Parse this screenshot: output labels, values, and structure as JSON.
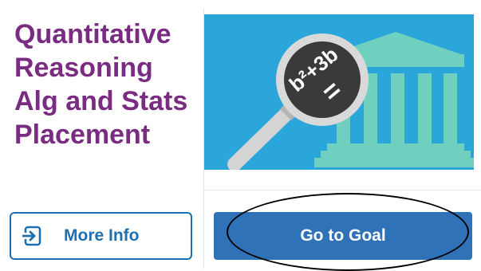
{
  "course": {
    "title": "Quantitative\nReasoning\nAlg and Stats\nPlacement"
  },
  "hero": {
    "formula_top": "b²+3b",
    "formula_equals": "="
  },
  "actions": {
    "more_info_label": "More Info",
    "go_to_goal_label": "Go to Goal"
  },
  "colors": {
    "title": "#7a2b82",
    "hero_bg": "#2aa6da",
    "building": "#6fd0c0",
    "primary_button": "#2f72b7",
    "outline_button": "#1e6fb0"
  },
  "icons": {
    "more_info": "login-arrow-icon",
    "hero": "magnifier-formula-illustration"
  }
}
